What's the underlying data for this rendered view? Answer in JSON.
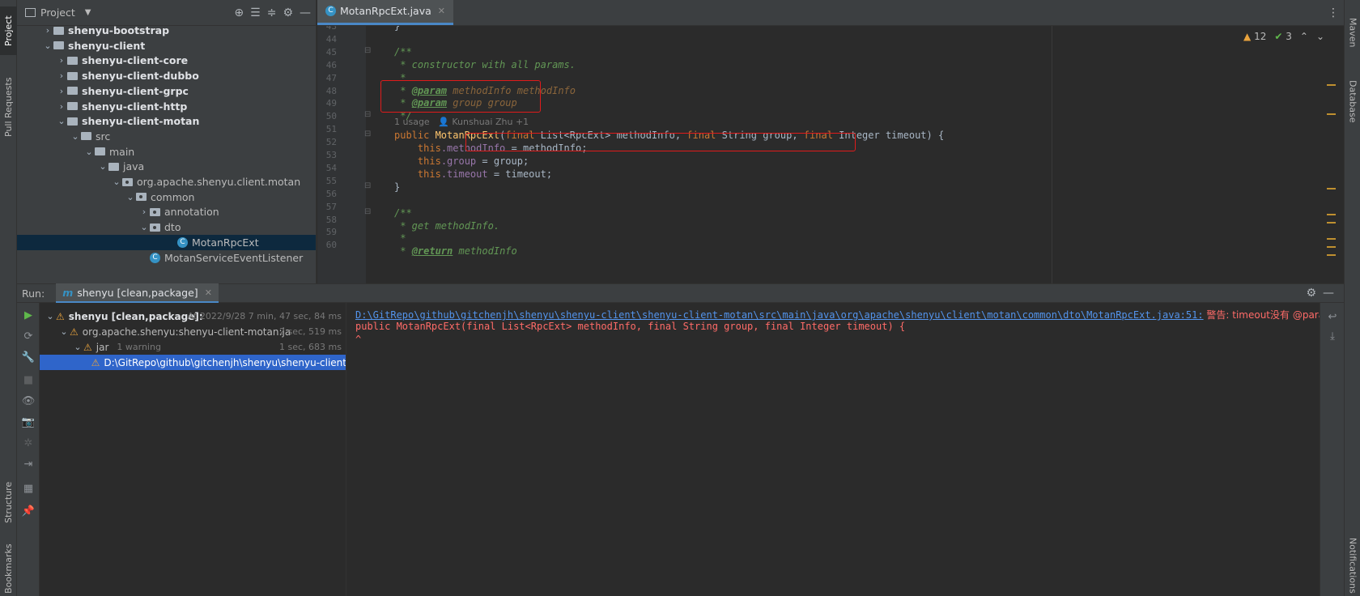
{
  "left_strip": {
    "project_tab": "Project",
    "pull_requests_tab": "Pull Requests",
    "structure_tab": "Structure",
    "bookmarks_tab": "Bookmarks"
  },
  "right_strip": {
    "maven_tab": "Maven",
    "database_tab": "Database",
    "notifications_tab": "Notifications"
  },
  "project_panel": {
    "title": "Project",
    "tree": [
      {
        "label": "shenyu-bootstrap",
        "depth": 1,
        "chevron": "›",
        "bold": true,
        "icon": "folder-icon"
      },
      {
        "label": "shenyu-client",
        "depth": 1,
        "chevron": "⌄",
        "bold": true,
        "icon": "folder-icon"
      },
      {
        "label": "shenyu-client-core",
        "depth": 2,
        "chevron": "›",
        "bold": true,
        "icon": "folder-icon"
      },
      {
        "label": "shenyu-client-dubbo",
        "depth": 2,
        "chevron": "›",
        "bold": true,
        "icon": "folder-icon"
      },
      {
        "label": "shenyu-client-grpc",
        "depth": 2,
        "chevron": "›",
        "bold": true,
        "icon": "folder-icon"
      },
      {
        "label": "shenyu-client-http",
        "depth": 2,
        "chevron": "›",
        "bold": true,
        "icon": "folder-icon"
      },
      {
        "label": "shenyu-client-motan",
        "depth": 2,
        "chevron": "⌄",
        "bold": true,
        "icon": "folder-icon"
      },
      {
        "label": "src",
        "depth": 3,
        "chevron": "⌄",
        "bold": false,
        "icon": "folder-icon"
      },
      {
        "label": "main",
        "depth": 4,
        "chevron": "⌄",
        "bold": false,
        "icon": "folder-icon"
      },
      {
        "label": "java",
        "depth": 5,
        "chevron": "⌄",
        "bold": false,
        "icon": "folder-icon"
      },
      {
        "label": "org.apache.shenyu.client.motan",
        "depth": 6,
        "chevron": "⌄",
        "bold": false,
        "icon": "package-icon"
      },
      {
        "label": "common",
        "depth": 7,
        "chevron": "⌄",
        "bold": false,
        "icon": "package-icon"
      },
      {
        "label": "annotation",
        "depth": 8,
        "chevron": "›",
        "bold": false,
        "icon": "package-icon"
      },
      {
        "label": "dto",
        "depth": 8,
        "chevron": "⌄",
        "bold": false,
        "icon": "package-icon"
      },
      {
        "label": "MotanRpcExt",
        "depth": 10,
        "chevron": "",
        "bold": false,
        "icon": "class-icon",
        "selected": true
      },
      {
        "label": "MotanServiceEventListener",
        "depth": 8,
        "chevron": "",
        "bold": false,
        "icon": "class-icon"
      }
    ]
  },
  "editor": {
    "tab_label": "MotanRpcExt.java",
    "inspections": {
      "warnings": "12",
      "ok": "3"
    },
    "usage_hint": "1 usage",
    "author_hint": "Kunshuai Zhu +1",
    "line_numbers": [
      "43",
      "44",
      "45",
      "46",
      "47",
      "48",
      "49",
      "50",
      "51",
      "52",
      "53",
      "54",
      "55",
      "56",
      "57",
      "58",
      "59",
      "60"
    ],
    "lines": {
      "l43": "}",
      "l45": "/**",
      "l46": " * constructor with all params.",
      "l47": " *",
      "l48_star": " * ",
      "l48_tag": "@param",
      "l48_rest": " methodInfo methodInfo",
      "l49_star": " * ",
      "l49_tag": "@param",
      "l49_rest": " group group",
      "l50": " */",
      "l51_public": "public ",
      "l51_name": "MotanRpcExt",
      "l51_open": "(",
      "l51_final1": "final ",
      "l51_type1": "List<RpcExt> methodInfo, ",
      "l51_final2": "final ",
      "l51_type2": "String group, ",
      "l51_final3": "final ",
      "l51_type3": "Integer timeout) {",
      "l52_this": "this",
      "l52_field": ".methodInfo",
      "l52_rest": " = methodInfo;",
      "l53_this": "this",
      "l53_field": ".group",
      "l53_rest": " = group;",
      "l54_this": "this",
      "l54_field": ".timeout",
      "l54_rest": " = timeout;",
      "l55": "}",
      "l57": "/**",
      "l58": " * get methodInfo.",
      "l59": " *",
      "l60_star": " * ",
      "l60_tag": "@return",
      "l60_rest": " methodInfo"
    }
  },
  "run_panel": {
    "run_label": "Run:",
    "tab_icon": "m",
    "tab_label": "shenyu [clean,package]",
    "tree": [
      {
        "label": "shenyu [clean,package]:",
        "time": "At 2022/9/28 7 min, 47 sec, 84 ms",
        "depth": 0,
        "chevron": "⌄"
      },
      {
        "label": "org.apache.shenyu:shenyu-client-motan:ja",
        "time": "2 sec, 519 ms",
        "depth": 1,
        "chevron": "⌄"
      },
      {
        "label": "jar",
        "time": "1 sec, 683 ms",
        "extra": "1 warning",
        "depth": 2,
        "chevron": "⌄"
      },
      {
        "label": "D:\\GitRepo\\github\\gitchenjh\\shenyu\\shenyu-client",
        "time": "",
        "depth": 3,
        "chevron": "",
        "selected": true
      }
    ],
    "console": {
      "link": "D:\\GitRepo\\github\\gitchenjh\\shenyu\\shenyu-client\\shenyu-client-motan\\src\\main\\java\\org\\apache\\shenyu\\client\\motan\\common\\dto\\MotanRpcExt.java:51:",
      "warning": " 警告: timeout没有 @param",
      "line2": "public MotanRpcExt(final List<RpcExt> methodInfo, final String group, final Integer timeout) {",
      "line3": "^"
    }
  }
}
